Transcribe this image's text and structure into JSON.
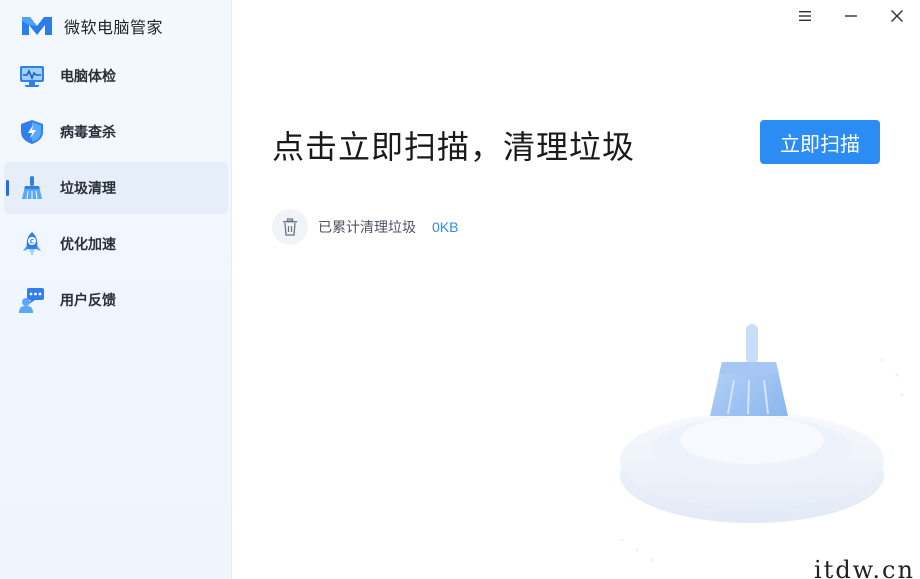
{
  "app": {
    "title": "微软电脑管家"
  },
  "sidebar": {
    "items": [
      {
        "label": "电脑体检",
        "icon": "monitor-checkup-icon",
        "active": false
      },
      {
        "label": "病毒查杀",
        "icon": "shield-lightning-icon",
        "active": false
      },
      {
        "label": "垃圾清理",
        "icon": "broom-icon",
        "active": true
      },
      {
        "label": "优化加速",
        "icon": "rocket-icon",
        "active": false
      },
      {
        "label": "用户反馈",
        "icon": "feedback-chat-icon",
        "active": false
      }
    ]
  },
  "main": {
    "headline": "点击立即扫描，清理垃圾",
    "scan_button": "立即扫描",
    "stat_label": "已累计清理垃圾",
    "stat_value": "0KB"
  },
  "window_controls": {
    "menu": "menu-icon",
    "minimize": "minimize-icon",
    "close": "close-icon"
  },
  "watermark": "itdw.cn",
  "colors": {
    "accent": "#2b8cf4",
    "sidebar_bg": "#f3f8fe",
    "active_item_bg": "#e5eef9"
  }
}
